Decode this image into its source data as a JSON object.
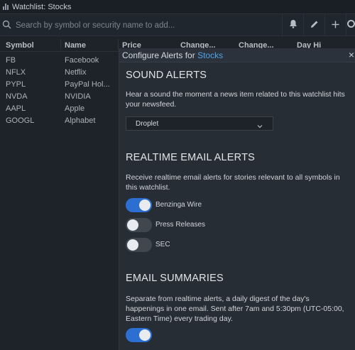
{
  "window": {
    "title": "Watchlist: Stocks"
  },
  "search": {
    "placeholder": "Search by symbol or security name to add..."
  },
  "toolbar": {
    "icons": [
      "bell-icon",
      "pencil-icon",
      "plus-icon",
      "settings-icon"
    ]
  },
  "grid": {
    "columns": [
      "Symbol",
      "Name",
      "Price",
      "Change...",
      "Change...",
      "Day Hi"
    ],
    "rows": [
      {
        "symbol": "FB",
        "name": "Facebook"
      },
      {
        "symbol": "NFLX",
        "name": "Netflix"
      },
      {
        "symbol": "PYPL",
        "name": "PayPal Hol..."
      },
      {
        "symbol": "NVDA",
        "name": "NVIDIA"
      },
      {
        "symbol": "AAPL",
        "name": "Apple"
      },
      {
        "symbol": "GOOGL",
        "name": "Alphabet"
      }
    ]
  },
  "modal": {
    "title_prefix": "Configure Alerts for ",
    "title_link": "Stocks",
    "close": "×",
    "sound": {
      "title": "SOUND ALERTS",
      "description": "Hear a sound the moment a news item related to this watchlist hits your newsfeed.",
      "selected_sound": "Droplet"
    },
    "realtime": {
      "title": "REALTIME EMAIL ALERTS",
      "description": "Receive realtime email alerts for stories relevant to all symbols in this watchlist.",
      "toggles": [
        {
          "label": "Benzinga Wire",
          "on": true
        },
        {
          "label": "Press Releases",
          "on": false
        },
        {
          "label": "SEC",
          "on": false
        }
      ]
    },
    "summaries": {
      "title": "EMAIL SUMMARIES",
      "description": "Separate from realtime alerts, a daily digest of the day's happenings in one email. Sent after 7am and 5:30pm (UTC-05:00, Eastern Time) every trading day.",
      "toggle_on": true
    }
  },
  "colors": {
    "accent": "#2d6fd0",
    "link": "#4fa3e8",
    "background": "#1e2329",
    "panel": "#262d35"
  }
}
